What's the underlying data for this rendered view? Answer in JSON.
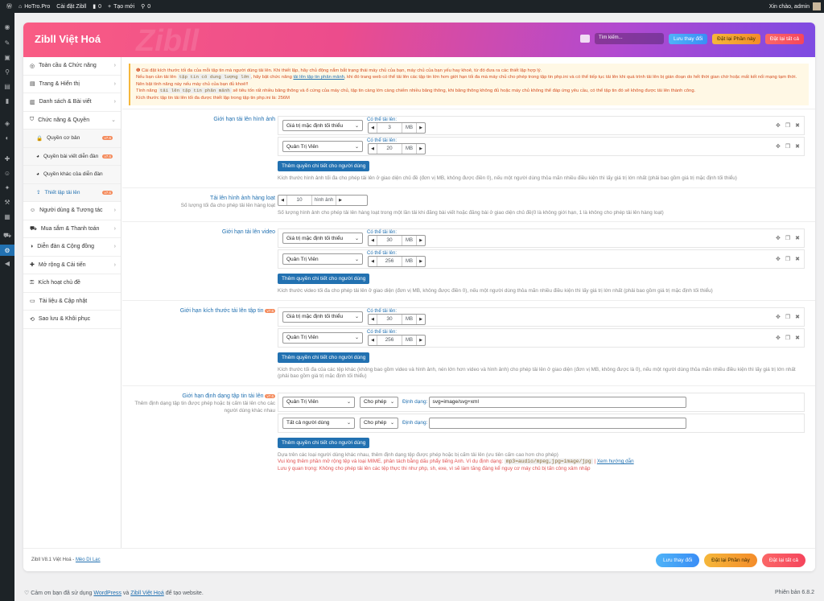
{
  "adminbar": {
    "site": "HoTro.Pro",
    "install": "Cài đặt Zibll",
    "comments": "0",
    "new": "Tạo mới",
    "links": "0",
    "greeting": "Xin chào, admin"
  },
  "header": {
    "brand": "Zibll Việt Hoá",
    "watermark": "Zibll",
    "search_placeholder": "Tìm kiếm...",
    "save": "Lưu thay đổi",
    "reset_section": "Đặt lại Phần này",
    "reset_all": "Đặt lại tất cả"
  },
  "nav": [
    {
      "label": "Toàn cầu & Chức năng",
      "icon": "globe-icon",
      "chev": true
    },
    {
      "label": "Trang & Hiển thị",
      "icon": "page-icon",
      "chev": true
    },
    {
      "label": "Danh sách & Bài viết",
      "icon": "book-icon",
      "chev": true
    },
    {
      "label": "Chức năng & Quyền",
      "icon": "shield-icon",
      "chev": true
    },
    {
      "label": "Quyền cơ bản",
      "icon": "lock-icon",
      "sub": true,
      "badge": "v7.6"
    },
    {
      "label": "Quyền bài viết diễn đàn",
      "icon": "forum-icon",
      "sub": true,
      "badge": "v7.6"
    },
    {
      "label": "Quyền khác của diễn đàn",
      "icon": "forum2-icon",
      "sub": true
    },
    {
      "label": "Thiết lập tải lên",
      "icon": "upload-icon",
      "sub": true,
      "active": true,
      "badge": "v7.6"
    },
    {
      "label": "Người dùng & Tương tác",
      "icon": "user-icon",
      "chev": true
    },
    {
      "label": "Mua sắm & Thanh toán",
      "icon": "cart-icon",
      "chev": true
    },
    {
      "label": "Diễn đàn & Cộng đồng",
      "icon": "community-icon",
      "chev": true
    },
    {
      "label": "Mở rộng & Cải tiến",
      "icon": "extend-icon",
      "chev": true
    },
    {
      "label": "Kích hoạt chủ đề",
      "icon": "key-icon"
    },
    {
      "label": "Tài liệu & Cập nhật",
      "icon": "doc-icon"
    },
    {
      "label": "Sao lưu & Khôi phục",
      "icon": "backup-icon"
    }
  ],
  "notice": {
    "line1": "Cài đặt kích thước tối đa của mỗi tập tin mà người dùng tải lên. Khi thiết lập, hãy chủ động nắm bắt trạng thái máy chủ của bạn, máy chủ của bạn yếu hay khoẻ, từ đó đưa ra các thiết lập hợp lý.",
    "line2a": "Nếu bạn cần tải lên",
    "code1": "tập tin có dung lượng lớn",
    "line2b": ", hãy bật chức năng",
    "link": "tải lên tập tin phân mảnh",
    "line2c": ", khi đó trang web có thể tải lên các tập tin lớn hơn giới hạn tối đa mà máy chủ cho phép trong tập tin php.ini và có thể tiếp tục tải lên khi quá trình tải lên bị gián đoạn do hết thời gian chờ hoặc mất kết nối mạng tạm thời. Nên bật tính năng này nếu máy chủ của bạn đủ khoẻ!!",
    "line3a": "Tính năng",
    "code2": "tải lên tập tin phân mảnh",
    "line3b": "sẽ tiêu tốn rất nhiều băng thông và ổ cứng của máy chủ, tập tin càng lớn càng chiếm nhiều băng thông, khi băng thông không đủ hoặc máy chủ không thể đáp ứng yêu cầu, có thể tập tin đó sẽ không được tải lên thành công.",
    "line4": "Kích thước tập tin tải lên tối đa được thiết lập trong tập tin php.ini là: 256M"
  },
  "sections": {
    "image": {
      "label": "Giới hạn tải lên hình ảnh",
      "rows": [
        {
          "role": "Giá trị mặc định tối thiểu",
          "cap": "Có thể tải lên:",
          "value": "3",
          "unit": "MB"
        },
        {
          "role": "Quản Trị Viên",
          "cap": "Có thể tải lên:",
          "value": "20",
          "unit": "MB"
        }
      ],
      "add": "Thêm quyền chi tiết cho người dùng",
      "help": "Kích thước hình ảnh tối đa cho phép tải lên ở giao diện chủ đề (đơn vị MB, không được điền 0), nếu một người dùng thỏa mãn nhiều điều kiện thì lấy giá trị lớn nhất (phải bao gồm giá trị mặc định tối thiểu)"
    },
    "batch": {
      "label": "Tải lên hình ảnh hàng loạt",
      "desc": "Số lượng tối đa cho phép tải lên hàng loạt",
      "value": "10",
      "unit": "hình ảnh",
      "help": "Số lượng hình ảnh cho phép tải lên hàng loạt trong một lần tải khi đăng bài viết hoặc đăng bài ở giao diện chủ đề(0 là không giới hạn, 1 là không cho phép tải lên hàng loạt)"
    },
    "video": {
      "label": "Giới hạn tải lên video",
      "rows": [
        {
          "role": "Giá trị mặc định tối thiểu",
          "cap": "Có thể tải lên:",
          "value": "30",
          "unit": "MB"
        },
        {
          "role": "Quản Trị Viên",
          "cap": "Có thể tải lên:",
          "value": "256",
          "unit": "MB"
        }
      ],
      "add": "Thêm quyền chi tiết cho người dùng",
      "help": "Kích thước video tối đa cho phép tải lên ở giao diện (đơn vị MB, không được điền 0), nếu một người dùng thỏa mãn nhiều điều kiện thì lấy giá trị lớn nhất (phải bao gồm giá trị mặc định tối thiểu)"
    },
    "file": {
      "label": "Giới hạn kích thước tải lên tập tin",
      "badge": "v7.6",
      "rows": [
        {
          "role": "Giá trị mặc định tối thiểu",
          "cap": "Có thể tải lên:",
          "value": "30",
          "unit": "MB"
        },
        {
          "role": "Quản Trị Viên",
          "cap": "Có thể tải lên:",
          "value": "256",
          "unit": "MB"
        }
      ],
      "add": "Thêm quyền chi tiết cho người dùng",
      "help": "Kích thước tối đa của các tệp khác (không bao gồm video và hình ảnh, nén lớn hơn video và hình ảnh) cho phép tải lên ở giao diện (đơn vị MB, không được là 0), nếu một người dùng thỏa mãn nhiều điều kiện thì lấy giá trị lớn nhất (phải bao gồm giá trị mặc định tối thiểu)"
    },
    "format": {
      "label": "Giới hạn định dạng tập tin tải lên",
      "badge": "v7.6",
      "desc": "Thêm định dạng tập tin được phép hoặc bị cấm tải lên cho các người dùng khác nhau",
      "rows": [
        {
          "role": "Quản Trị Viên",
          "perm": "Cho phép",
          "cap": "Định dạng:",
          "value": "svg=image/svg+xml"
        },
        {
          "role": "Tất cả người dùng",
          "perm": "Cho phép",
          "cap": "Định dạng:",
          "value": ""
        }
      ],
      "add": "Thêm quyền chi tiết cho người dùng",
      "help1": "Dựa trên các loại người dùng khác nhau, thêm định dạng tệp được phép hoặc bị cấm tải lên (ưu tiên cấm cao hơn cho phép)",
      "help2a": "Vui lòng thêm phần mở rộng tệp và loại MIME, phân tách bằng dấu phẩy tiếng Anh. Ví dụ định dạng:",
      "help2code": "mp3=audio/mpeg,jpg=image/jpg",
      "help2sep": "|",
      "help2link": "Xem hướng dẫn",
      "help3": "Lưu ý quan trọng: Không cho phép tải lên các tệp thực thi như php, sh, exe, vì sẽ làm tăng đáng kể nguy cơ máy chủ bị tấn công xâm nhập"
    }
  },
  "footer": {
    "version": "Zibll V8.1 Việt Hoá",
    "sep": "-",
    "author": "Mèo Dì Lạc",
    "save": "Lưu thay đổi",
    "reset_section": "Đặt lại Phần này",
    "reset_all": "Đặt lại tất cả"
  },
  "wpfooter": {
    "thanks_a": "Cảm ơn bạn đã sử dụng",
    "wp": "WordPress",
    "and": "và",
    "zibll": "Zibll Việt Hoá",
    "thanks_b": "để tạo website.",
    "version": "Phiên bản 6.8.2"
  },
  "icons": {
    "row_actions": [
      "move-icon",
      "copy-icon",
      "delete-icon"
    ]
  }
}
